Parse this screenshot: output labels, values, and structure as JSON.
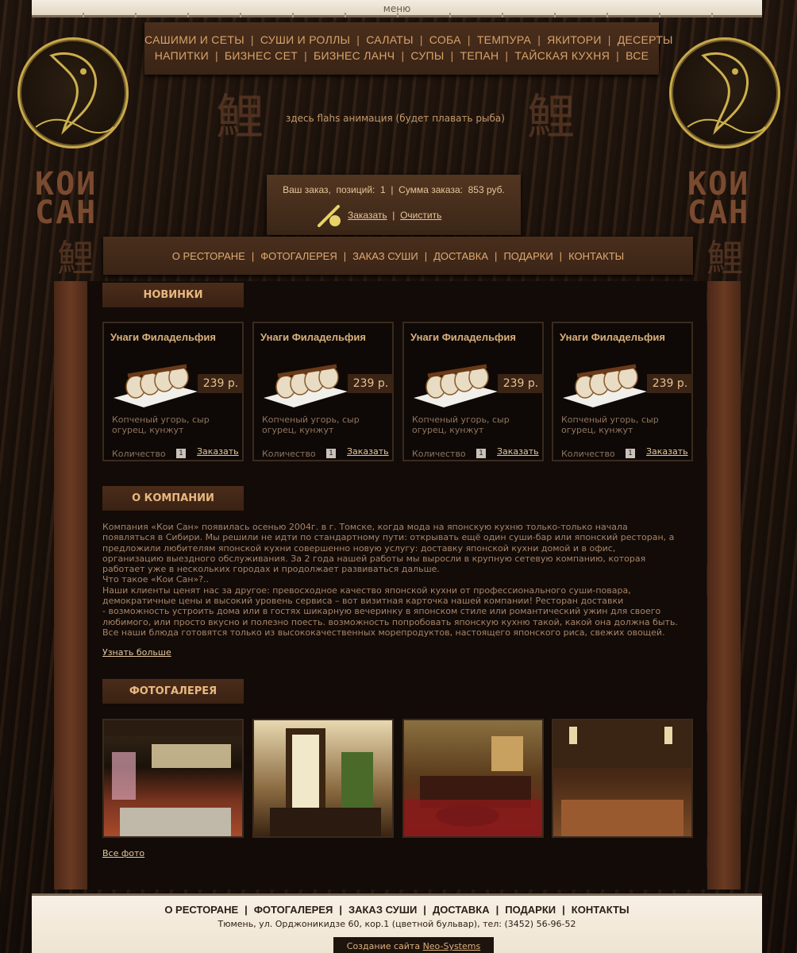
{
  "top": {
    "label": "меню"
  },
  "menu": {
    "row1": [
      "САШИМИ И СЕТЫ",
      "СУШИ И РОЛЛЫ",
      "САЛАТЫ",
      "СОБА",
      "ТЕМПУРА",
      "ЯКИТОРИ",
      "ДЕСЕРТЫ"
    ],
    "row2": [
      "НАПИТКИ",
      "БИЗНЕС СЕТ",
      "БИЗНЕС ЛАНЧ",
      "СУПЫ",
      "ТЕПАН",
      "ТАЙСКАЯ КУХНЯ",
      "ВСЕ"
    ]
  },
  "flash_text": "здесь flahs анимация (будет плавать рыба)",
  "logo": {
    "line1": "КОИ",
    "line2": "САН",
    "kanji": "鯉"
  },
  "order": {
    "prefix": "Ваш заказ,",
    "positions_label": "позиций:",
    "positions": "1",
    "sum_label": "Сумма заказа:",
    "sum": "853 руб.",
    "order_link": "Заказать",
    "clear_link": "Очистить"
  },
  "nav": [
    "О РЕСТОРАНЕ",
    "ФОТОГАЛЕРЕЯ",
    "ЗАКАЗ СУШИ",
    "ДОСТАВКА",
    "ПОДАРКИ",
    "КОНТАКТЫ"
  ],
  "sections": {
    "new": "НОВИНКИ",
    "company": "О КОМПАНИИ",
    "gallery": "ФОТОГАЛЕРЕЯ"
  },
  "products": [
    {
      "title": "Унаги Филадельфия",
      "price": "239 р.",
      "desc": "Копченый угорь, сыр огурец, кунжут",
      "qty_label": "Количество",
      "qty": "1",
      "order": "Заказать"
    },
    {
      "title": "Унаги Филадельфия",
      "price": "239 р.",
      "desc": "Копченый угорь, сыр огурец, кунжут",
      "qty_label": "Количество",
      "qty": "1",
      "order": "Заказать"
    },
    {
      "title": "Унаги Филадельфия",
      "price": "239 р.",
      "desc": "Копченый угорь, сыр огурец, кунжут",
      "qty_label": "Количество",
      "qty": "1",
      "order": "Заказать"
    },
    {
      "title": "Унаги Филадельфия",
      "price": "239 р.",
      "desc": "Копченый угорь, сыр огурец, кунжут",
      "qty_label": "Количество",
      "qty": "1",
      "order": "Заказать"
    }
  ],
  "about": {
    "lines": [
      "Компания «Кои Сан» появилась осенью 2004г. в г. Томске, когда мода на японскую кухню только-только начала",
      "появляться в Сибири. Мы решили не идти по стандартному пути: открывать ещё один суши-бар или японский ресторан, а",
      "предложили любителям японской кухни совершенно новую услугу: доставку японской кухни домой и в офис,",
      "организацию выездного обслуживания. За 2 года нашей работы мы выросли в крупную сетевую компанию, которая",
      "работает уже в нескольких городах и продолжает развиваться дальше.",
      "Что такое «Кои Сан»?..",
      "Наши клиенты ценят нас за другое: превосходное качество японской кухни от профессионального суши-повара,",
      "демократичные цены и высокий уровень сервиса – вот визитная карточка нашей компании! Ресторан доставки",
      "- возможность устроить дома или в гостях шикарную вечеринку в японском стиле или романтический ужин для своего",
      "любимого, или просто вкусно и полезно поесть. возможность попробовать японскую кухню такой, какой она должна быть.",
      "Все наши блюда готовятся только из высококачественных морепродуктов, настоящего японского риса, свежих овощей."
    ],
    "more": "Узнать больше"
  },
  "gallery": {
    "all": "Все фото"
  },
  "footer": {
    "nav": [
      "О РЕСТОРАНЕ",
      "ФОТОГАЛЕРЕЯ",
      "ЗАКАЗ СУШИ",
      "ДОСТАВКА",
      "ПОДАРКИ",
      "КОНТАКТЫ"
    ],
    "address": "Тюмень, ул. Орджоникидзе 60, кор.1 (цветной бульвар), тел: (3452) 56-96-52",
    "credit_prefix": "Создание сайта",
    "credit_link": "Neo-Systems"
  }
}
